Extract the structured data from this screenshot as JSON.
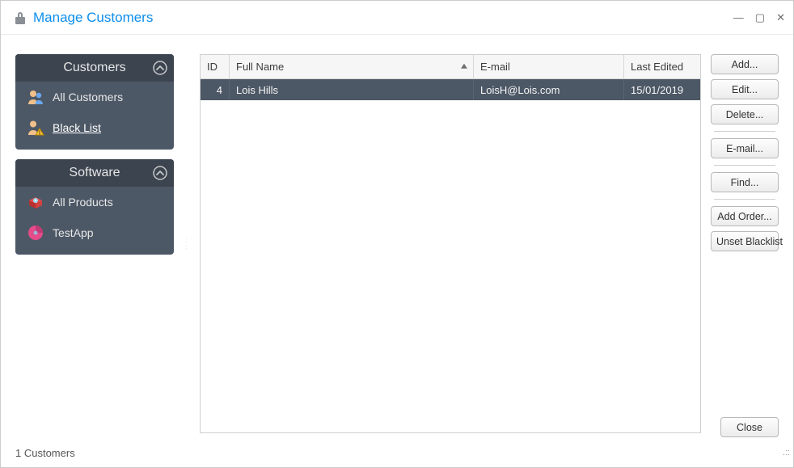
{
  "window": {
    "title": "Manage Customers"
  },
  "sidebar": {
    "groups": [
      {
        "title": "Customers",
        "items": [
          {
            "icon": "users-icon",
            "label": "All Customers"
          },
          {
            "icon": "blacklist-icon",
            "label": "Black List",
            "selected": true
          }
        ]
      },
      {
        "title": "Software",
        "items": [
          {
            "icon": "product-icon",
            "label": "All Products"
          },
          {
            "icon": "testapp-icon",
            "label": "TestApp"
          }
        ]
      }
    ]
  },
  "table": {
    "columns": {
      "id": "ID",
      "full_name": "Full Name",
      "email": "E-mail",
      "last_edited": "Last Edited"
    },
    "rows": [
      {
        "id": "4",
        "full_name": "Lois Hills",
        "email": "LoisH@Lois.com",
        "last_edited": "15/01/2019"
      }
    ]
  },
  "actions": {
    "add": "Add...",
    "edit": "Edit...",
    "delete": "Delete...",
    "email": "E-mail...",
    "find": "Find...",
    "add_order": "Add Order...",
    "unset_blacklist": "Unset Blacklist"
  },
  "footer": {
    "close": "Close",
    "status": "1 Customers"
  }
}
